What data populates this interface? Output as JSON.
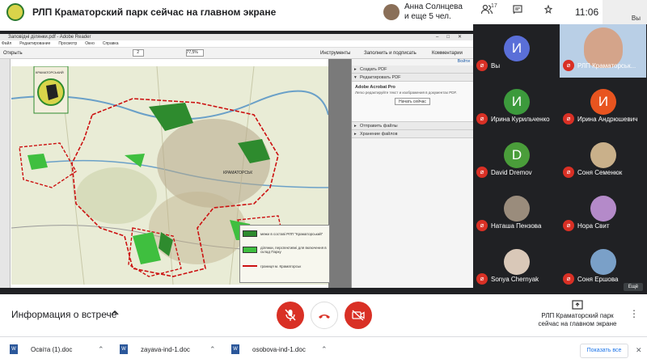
{
  "topbar": {
    "title": "РЛП Краматорский парк сейчас на главном экране",
    "presenter_line1": "Анна Солнцева",
    "presenter_line2": "и еще 5 чел.",
    "participants_count": "17",
    "time": "11:06",
    "self_label": "Вы"
  },
  "acrobat": {
    "window_title": "Заповідні ділянки.pdf - Adobe Reader",
    "menu": [
      "Файл",
      "Редактирование",
      "Просмотр",
      "Окно",
      "Справка"
    ],
    "open_label": "Открыть",
    "page_number": "2",
    "zoom": "77,5%",
    "tools_label": "Инструменты",
    "fill_sign_label": "Заполнить и подписать",
    "comments_label": "Комментарии",
    "sign_in_label": "Войти",
    "panel_create_pdf": "Создать PDF",
    "panel_edit_pdf": "Редактировать PDF",
    "product_name": "Adobe Acrobat Pro",
    "product_desc": "Легко редактируйте текст и изображения в документах PDF.",
    "start_now": "Начать сейчас",
    "panel_send_files": "Отправить файлы",
    "panel_store_files": "Хранение файлов"
  },
  "map": {
    "logo_text": "КРАМАТОРСЬКИЙ",
    "city_label": "КРАМАТОРСЬК",
    "legend": [
      {
        "text": "межи в составі РЛП \"Краматорський\"",
        "color": "#2e8b2e"
      },
      {
        "text": "ділянки, перспективні для включення в склад Парку",
        "color": "#3fbf3f"
      },
      {
        "text": "границя м. Краматорськ",
        "color": "#cc1111"
      }
    ]
  },
  "participants": [
    {
      "name": "Вы",
      "initial": "И",
      "color": "#5a6fd8",
      "photo": false
    },
    {
      "name": "РЛП Краматорськ...",
      "initial": "",
      "color": "#9ab8d8",
      "photo": true
    },
    {
      "name": "Ирина Курильченко",
      "initial": "И",
      "color": "#3c9a3c",
      "photo": false
    },
    {
      "name": "Ирина Андрюшевич",
      "initial": "И",
      "color": "#e8541f",
      "photo": false
    },
    {
      "name": "David Dremov",
      "initial": "D",
      "color": "#4a9d3a",
      "photo": false
    },
    {
      "name": "Соня Семенюк",
      "initial": "",
      "color": "#c9b08a",
      "photo": true
    },
    {
      "name": "Наташа Пензова",
      "initial": "",
      "color": "#9a8c7c",
      "photo": true
    },
    {
      "name": "Нора Свит",
      "initial": "",
      "color": "#b48ac9",
      "photo": true
    },
    {
      "name": "Sonya Chernyak",
      "initial": "",
      "color": "#d9c8b8",
      "photo": true
    },
    {
      "name": "Соня Ершова",
      "initial": "",
      "color": "#7aa0c8",
      "photo": true
    }
  ],
  "more_tag": "Ещё",
  "controls": {
    "meeting_info": "Информация о встрече",
    "presenting_text": "РЛП Краматорский парк сейчас на главном экране"
  },
  "downloads": {
    "files": [
      "Освіта (1).doc",
      "zayava-ind-1.doc",
      "osobova-ind-1.doc"
    ],
    "show_all": "Показать все"
  },
  "icons": {
    "mic_off": "mic-off-icon",
    "hang_up": "hang-up-icon",
    "camera_off": "camera-off-icon",
    "present": "present-icon",
    "more": "more-vert-icon"
  },
  "colors": {
    "meet_red": "#d93025",
    "tile_bg": "#202124",
    "link_blue": "#1a73e8"
  }
}
